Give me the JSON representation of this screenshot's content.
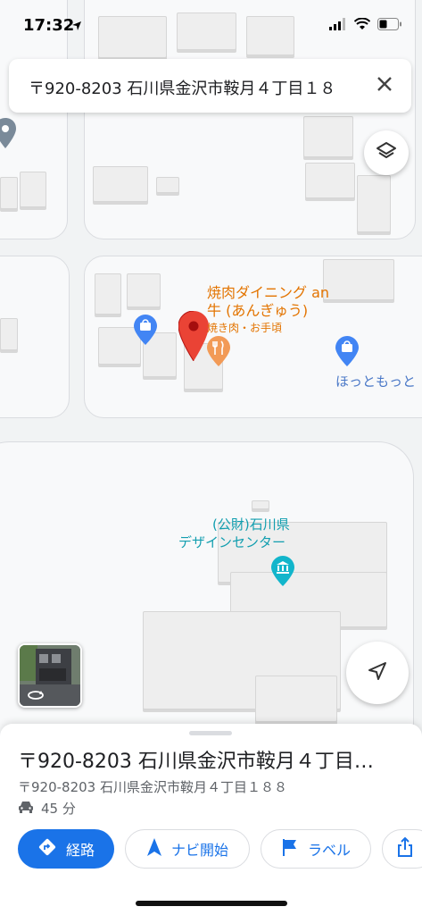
{
  "status_bar": {
    "time": "17:32"
  },
  "search": {
    "query": "〒920-8203 石川県金沢市鞍月４丁目１８"
  },
  "map": {
    "poi_restaurant": {
      "name_line1": "焼肉ダイニング an",
      "name_line2": "牛 (あんぎゅう)",
      "subtitle": "焼き肉・お手頃"
    },
    "poi_store": {
      "name": "ほっともっと"
    },
    "poi_museum": {
      "name_line1": "(公財)石川県",
      "name_line2": "デザインセンター"
    }
  },
  "place": {
    "title": "〒920-8203 石川県金沢市鞍月４丁目…",
    "address": "〒920-8203 石川県金沢市鞍月４丁目１８８",
    "eta": "45 分"
  },
  "actions": {
    "directions": "経路",
    "navigate": "ナビ開始",
    "label": "ラベル"
  },
  "colors": {
    "accent": "#1a73e8",
    "restaurant": "#e37400",
    "store": "#4285f4",
    "museum": "#12b5cb",
    "pin": "#ea4335"
  }
}
